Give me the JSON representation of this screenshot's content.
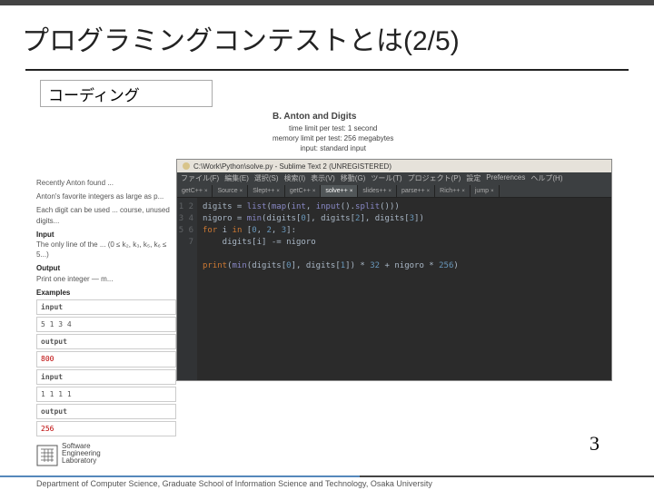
{
  "slide": {
    "title": "プログラミングコンテストとは(2/5)",
    "subtitle": "コーディング",
    "page_number": "3"
  },
  "problem": {
    "title": "B. Anton and Digits",
    "time_limit": "time limit per test: 1 second",
    "memory_limit": "memory limit per test: 256 megabytes",
    "input_mode": "input: standard input"
  },
  "left": {
    "p1": "Recently Anton found ...",
    "p2": "Anton's favorite integers as large as p...",
    "p3": "Each digit can be used ... course, unused digits...",
    "input_hdr": "Input",
    "input_txt": "The only line of the ... (0 ≤ k₂, k₃, k₅, k₆ ≤ 5...)",
    "output_hdr": "Output",
    "output_txt": "Print one integer — m...",
    "examples_hdr": "Examples",
    "ex1_in_lbl": "input",
    "ex1_in": "5 1 3 4",
    "ex1_out_lbl": "output",
    "ex1_out": "800",
    "ex2_in_lbl": "input",
    "ex2_in": "1 1 1 1",
    "ex2_out_lbl": "output",
    "ex2_out": "256"
  },
  "ide": {
    "window_title": "C:\\Work\\Python\\solve.py - Sublime Text 2 (UNREGISTERED)",
    "menu": [
      "ファイル(F)",
      "編集(E)",
      "選択(S)",
      "検索(I)",
      "表示(V)",
      "移動(G)",
      "ツール(T)",
      "プロジェクト(P)",
      "設定",
      "Preferences",
      "ヘルプ(H)"
    ],
    "tabs": [
      {
        "label": "getC++",
        "active": false
      },
      {
        "label": "Source",
        "active": false
      },
      {
        "label": "Slept++",
        "active": false
      },
      {
        "label": "getC++",
        "active": false
      },
      {
        "label": "solve++",
        "active": true
      },
      {
        "label": "slides++",
        "active": false
      },
      {
        "label": "parse++",
        "active": false
      },
      {
        "label": "Rich++",
        "active": false
      },
      {
        "label": "jump",
        "active": false
      }
    ],
    "code_lines": [
      "digits = list(map(int, input().split()))",
      "nigoro = min(digits[0], digits[2], digits[3])",
      "for i in [0, 2, 3]:",
      "    digits[i] -= nigoro",
      "",
      "print(min(digits[0], digits[1]) * 32 + nigoro * 256)",
      ""
    ],
    "gutter": [
      "1",
      "2",
      "3",
      "4",
      "5",
      "6",
      "7"
    ]
  },
  "logo": {
    "line1": "Software",
    "line2": "Engineering",
    "line3": "Laboratory"
  },
  "footer": "Department of Computer Science, Graduate School of Information Science and Technology, Osaka University"
}
